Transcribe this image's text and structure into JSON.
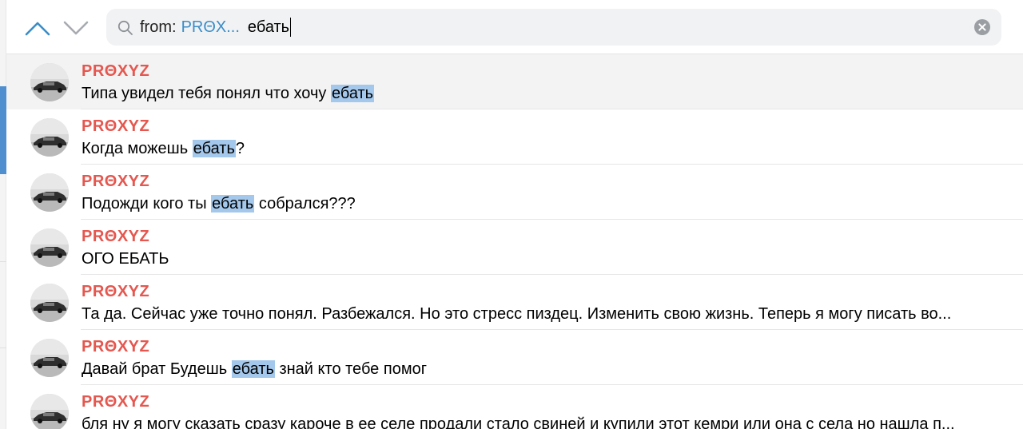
{
  "colors": {
    "accent": "#3a8dc8",
    "sender": "#e5574f",
    "highlight": "#a4c8ec",
    "active_row": "#f3f3f3"
  },
  "search": {
    "filter_prefix": "from:",
    "filter_value": "PRΘX...",
    "query": "ебать"
  },
  "nav": {
    "up_icon": "chevron-up-icon",
    "down_icon": "chevron-down-icon"
  },
  "results": [
    {
      "sender": "PRΘXYZ",
      "before": "Типа увидел тебя понял что хочу ",
      "match": "ебать",
      "after": "",
      "active": true
    },
    {
      "sender": "PRΘXYZ",
      "before": "Когда можешь ",
      "match": "ебать",
      "after": "?",
      "active": false
    },
    {
      "sender": "PRΘXYZ",
      "before": "Подожди кого ты ",
      "match": "ебать",
      "after": " собрался???",
      "active": false
    },
    {
      "sender": "PRΘXYZ",
      "before": "ОГО ЕБАТЬ",
      "match": "",
      "after": "",
      "active": false
    },
    {
      "sender": "PRΘXYZ",
      "before": "Та да. Сейчас уже точно понял. Разбежался. Но это стресс пиздец. Изменить свою жизнь. Теперь я могу писать во...",
      "match": "",
      "after": "",
      "active": false
    },
    {
      "sender": "PRΘXYZ",
      "before": "Давай брат Будешь ",
      "match": "ебать",
      "after": " знай кто тебе помог",
      "active": false
    },
    {
      "sender": "PRΘXYZ",
      "before": "бля ну я могу сказать сразу кароче в ее селе продали стало свиней и купили этот кемри или она с села но нашла п...",
      "match": "",
      "after": "",
      "active": false
    }
  ]
}
